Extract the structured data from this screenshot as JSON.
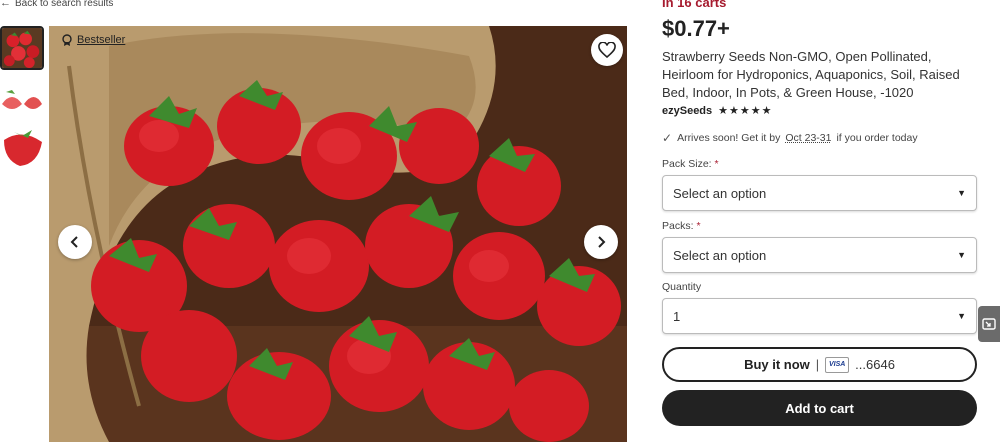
{
  "nav": {
    "back_label": "Back to search results"
  },
  "gallery": {
    "badge_label": "Bestseller",
    "icons": {
      "favorite": "heart-icon",
      "prev": "chevron-left-icon",
      "next": "chevron-right-icon",
      "badge": "medal-icon"
    }
  },
  "product": {
    "in_carts": "In 16 carts",
    "price": "$0.77+",
    "title": "Strawberry Seeds Non-GMO, Open Pollinated, Heirloom for Hydroponics, Aquaponics, Soil, Raised Bed, Indoor, In Pots, & Green House, -1020",
    "seller": "ezySeeds",
    "rating_stars": "★★★★★",
    "rating": 5,
    "arrives_prefix": "Arrives soon! Get it by",
    "arrives_dates": "Oct 23-31",
    "arrives_suffix": "if you order today"
  },
  "options": {
    "pack_size": {
      "label": "Pack Size:",
      "required": "*",
      "value": "Select an option"
    },
    "packs": {
      "label": "Packs:",
      "required": "*",
      "value": "Select an option"
    },
    "quantity": {
      "label": "Quantity",
      "value": "1"
    }
  },
  "actions": {
    "buy_now_label": "Buy it now",
    "separator": "|",
    "card_brand": "VISA",
    "card_number": "...6646",
    "add_to_cart_label": "Add to cart"
  },
  "colors": {
    "accent_red": "#a61a2e",
    "primary_button": "#222222"
  }
}
